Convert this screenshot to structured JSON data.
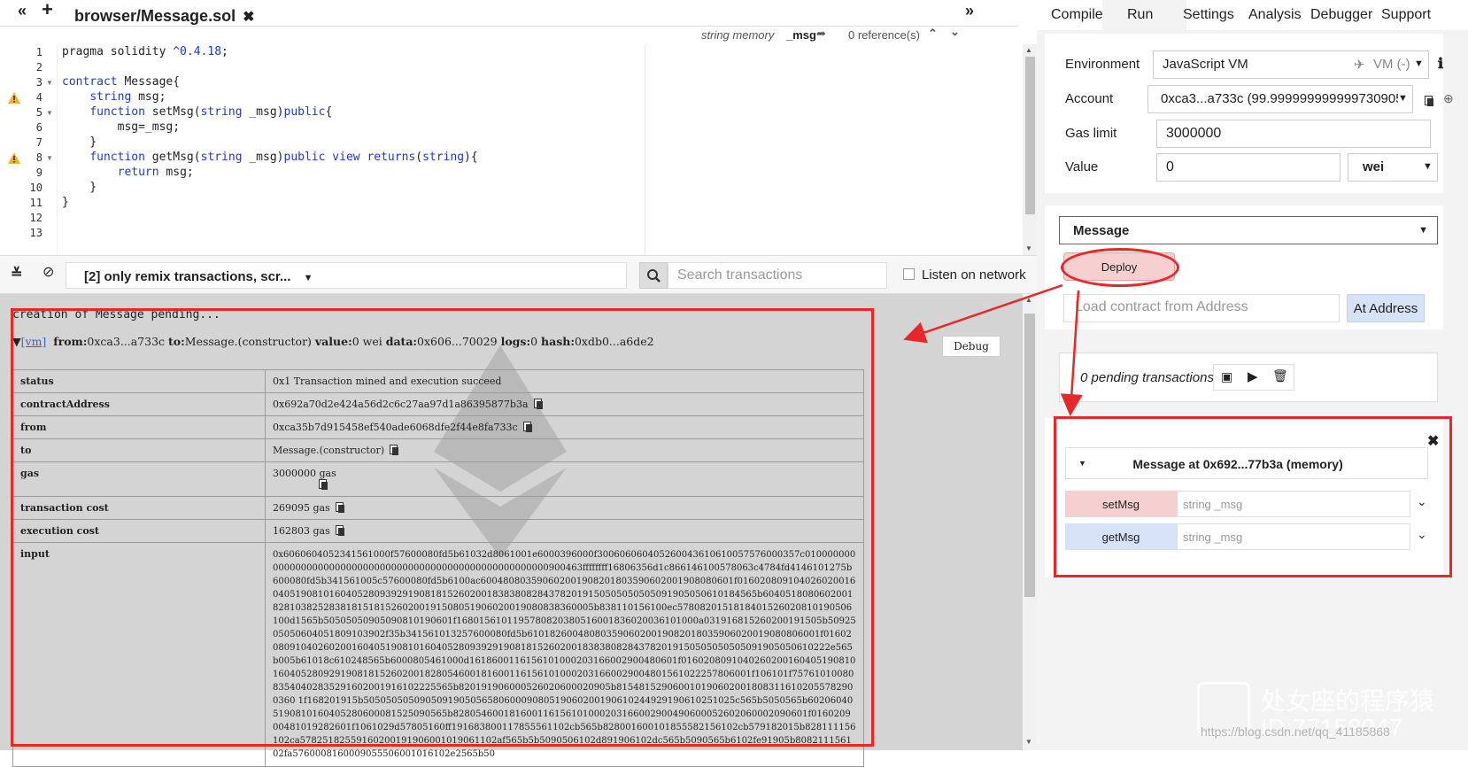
{
  "editor": {
    "tab_file": "browser/Message.sol",
    "info_type": "string memory",
    "info_name": "_msg",
    "info_refs": "0 reference(s)",
    "lines": [
      {
        "n": "1",
        "code": "pragma solidity ^0.4.18;"
      },
      {
        "n": "2",
        "code": ""
      },
      {
        "n": "3",
        "code": "contract Message{"
      },
      {
        "n": "4",
        "code": "    string msg;"
      },
      {
        "n": "5",
        "code": "    function setMsg(string _msg)public{"
      },
      {
        "n": "6",
        "code": "        msg=_msg;"
      },
      {
        "n": "7",
        "code": "    }"
      },
      {
        "n": "8",
        "code": "    function getMsg(string _msg)public view returns(string){"
      },
      {
        "n": "9",
        "code": "        return msg;"
      },
      {
        "n": "10",
        "code": "    }"
      },
      {
        "n": "11",
        "code": "}"
      },
      {
        "n": "12",
        "code": ""
      },
      {
        "n": "13",
        "code": ""
      }
    ]
  },
  "terminal": {
    "filter_label": "[2] only remix transactions, scr...",
    "search_placeholder": "Search transactions",
    "listen_label": "Listen on network",
    "pending_line": "creation of Message pending...",
    "tx_vm": "[vm]",
    "tx_from_label": "from:",
    "tx_from": "0xca3...a733c",
    "tx_to_label": "to:",
    "tx_to": "Message.(constructor)",
    "tx_value_label": "value:",
    "tx_value": "0 wei",
    "tx_data_label": "data:",
    "tx_data": "0x606...70029",
    "tx_logs_label": "logs:",
    "tx_logs": "0",
    "tx_hash_label": "hash:",
    "tx_hash": "0xdb0...a6de2",
    "debug_label": "Debug",
    "rows": {
      "status_k": "status",
      "status_v": "0x1 Transaction mined and execution succeed",
      "contract_k": "contractAddress",
      "contract_v": "0x692a70d2e424a56d2c6c27aa97d1a86395877b3a",
      "from_k": "from",
      "from_v": "0xca35b7d915458ef540ade6068dfe2f44e8fa733c",
      "to_k": "to",
      "to_v": "Message.(constructor)",
      "gas_k": "gas",
      "gas_v": "3000000 gas",
      "tcost_k": "transaction cost",
      "tcost_v": "269095 gas",
      "ecost_k": "execution cost",
      "ecost_v": "162803 gas",
      "input_k": "input",
      "input_v": "0x6060604052341561000f57600080fd5b61032d8061001e6000396000f300606060405260043610610057576000357c0100000000000000000000000000000000000000000000000000000000900463ffffffff16806356d1c866146100578063c4784fd4146101275b600080fd5b341561005c57600080fd5b6100ac600480803590602001908201803590602001908080601f01602080910402602001604051908101604052809392919081815260200183838082843782019150505050505091905050610184565b6040518080602001828103825283818151815260200191508051906020019080838360005b838110156100ec5780820151818401526020810190506100d1565b50505050905090810190601f1680156101195780820380516001836020036101000a031916815260200191505b5092505050604051809103902f35b341561013257600080fd5b6101826004808035906020019082018035906020019080806001f01602080910402602001604051908101604052809392919081815260200183838082843782019150505050505091905050610222e565b005b61018c610248565b6000805461000d1618600116156101000203166002900480601f01602080910402602001604051908101604052809291908181526020018280546001816001161561010002031660029004801561022257806001f106101f7576101008083540402835291602001916102225565b820191906000526020600020905b8154815290600101906020018083116102055782900360 1f168201915b505050505090509190505658060009080519060200190610244929190610251025c565b5050565b602060405190810160405280600081525090565b828054600181600116156101000203166002900490600052602060002090601f016020900481019282601f1061029d57805160ff191683800117855561102cb565b828001600101855582156102cb579182015b828111156102ca57825182559160200191906001019061102af565b5b5090506102d891906102dc565b5090565b6102fe91905b808211156102fa5760008160009055506001016102e2565b50"
    }
  },
  "right": {
    "tabs": [
      "Compile",
      "Run",
      "Settings",
      "Analysis",
      "Debugger",
      "Support"
    ],
    "env_label": "Environment",
    "env_value": "JavaScript VM",
    "env_vm": "VM (-)",
    "account_label": "Account",
    "account_value": "0xca3...a733c (99.999999999999730905",
    "gas_label": "Gas limit",
    "gas_value": "3000000",
    "value_label": "Value",
    "value_value": "0",
    "value_unit": "wei",
    "contract_select": "Message",
    "deploy_label": "Deploy",
    "addr_placeholder": "Load contract from Address",
    "at_address_label": "At Address",
    "pending_text": "0 pending transactions",
    "instance_title": "Message at 0x692...77b3a (memory)",
    "fn1_label": "setMsg",
    "fn1_placeholder": "string _msg",
    "fn2_label": "getMsg",
    "fn2_placeholder": "string _msg"
  },
  "watermark": {
    "text": "处女座的程序猿",
    "id": "ID:77158047",
    "url": "https://blog.csdn.net/qq_41185868"
  },
  "colors": {
    "annotation_red": "#e82828",
    "deploy_pink": "#f6d0d0",
    "call_blue": "#d6e2f6",
    "terminal_bg": "#d4d4d4"
  }
}
